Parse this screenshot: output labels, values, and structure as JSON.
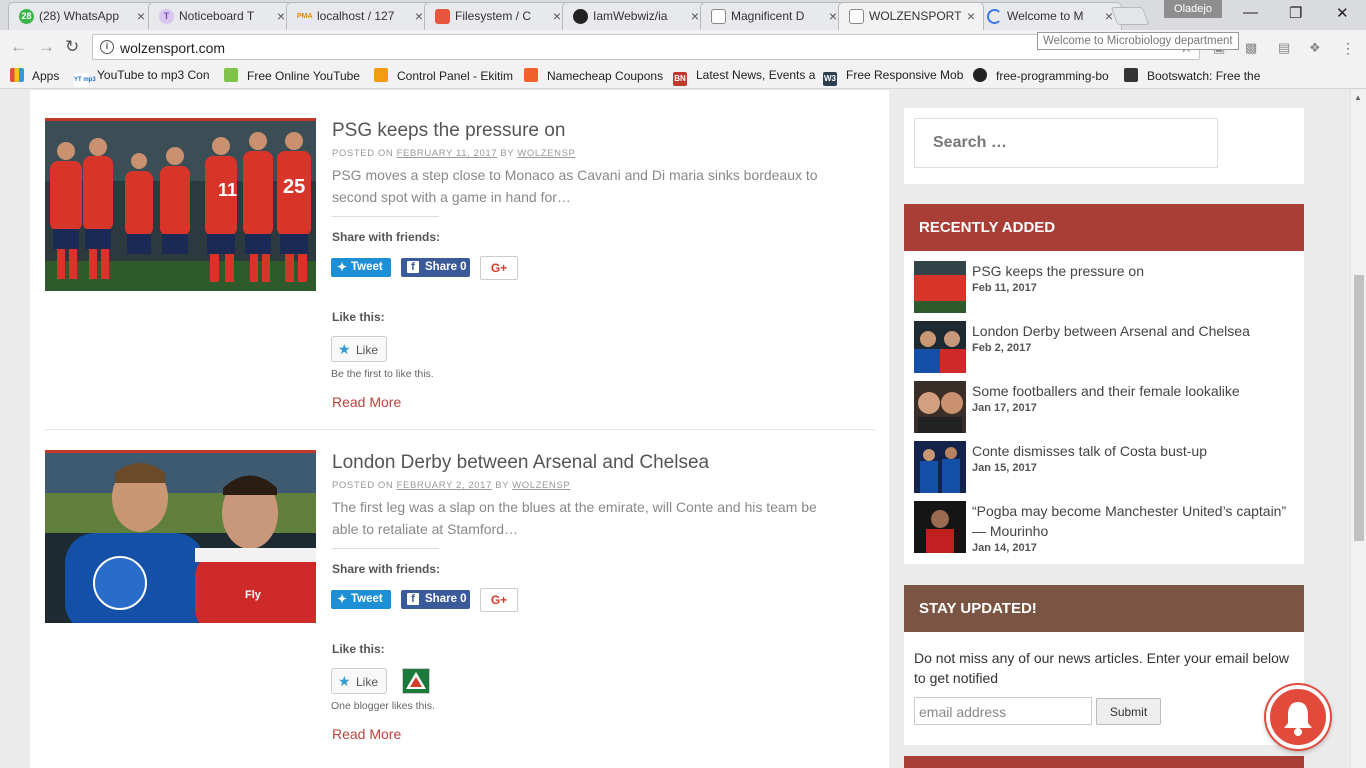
{
  "browser": {
    "tabs": [
      {
        "label": "(28) WhatsApp",
        "badge": "28"
      },
      {
        "label": "Noticeboard T",
        "badge": "T"
      },
      {
        "label": "localhost / 127",
        "badge": "PMA"
      },
      {
        "label": "Filesystem / C",
        "badge": ""
      },
      {
        "label": "IamWebwiz/ia",
        "badge": ""
      },
      {
        "label": "Magnificent D",
        "badge": ""
      },
      {
        "label": "WOLZENSPORT",
        "badge": ""
      },
      {
        "label": "Welcome to M",
        "badge": ""
      }
    ],
    "close_glyph": "×",
    "profile": "Oladejo",
    "url": "wolzensport.com",
    "tooltip": "Welcome to Microbiology department",
    "bookmarks": [
      {
        "label": "Apps"
      },
      {
        "label": "YouTube to mp3 Con",
        "icon": "YT mp3"
      },
      {
        "label": "Free Online YouTube"
      },
      {
        "label": "Control Panel - Ekitim"
      },
      {
        "label": "Namecheap Coupons"
      },
      {
        "label": "Latest News, Events a",
        "icon": "BN"
      },
      {
        "label": "Free Responsive Mob",
        "icon": "W3"
      },
      {
        "label": "free-programming-bo"
      },
      {
        "label": "Bootswatch: Free the"
      }
    ]
  },
  "posts": [
    {
      "title": "PSG keeps the pressure on",
      "posted_on": "POSTED ON",
      "date": "FEBRUARY 11, 2017",
      "by": "BY",
      "author": "WOLZENSP",
      "excerpt": "PSG moves a step close to Monaco as Cavani and Di maria sinks bordeaux to second spot with a game in hand for…",
      "share_heading": "Share with friends:",
      "tweet": "Tweet",
      "share": "Share 0",
      "gplus": "G+",
      "like_heading": "Like this:",
      "like": "Like",
      "like_note": "Be the first to like this.",
      "read_more": "Read More"
    },
    {
      "title": "London Derby between Arsenal and Chelsea",
      "posted_on": "POSTED ON",
      "date": "FEBRUARY 2, 2017",
      "by": "BY",
      "author": "WOLZENSP",
      "excerpt": "The first leg was a slap on the blues at the emirate, will Conte and his team be able to retaliate at Stamford…",
      "share_heading": "Share with friends:",
      "tweet": "Tweet",
      "share": "Share 0",
      "gplus": "G+",
      "like_heading": "Like this:",
      "like": "Like",
      "like_note": "One blogger likes this.",
      "read_more": "Read More"
    }
  ],
  "sidebar": {
    "search_placeholder": "Search …",
    "recent_heading": "RECENTLY ADDED",
    "recent": [
      {
        "title": "PSG keeps the pressure on",
        "date": "Feb 11, 2017"
      },
      {
        "title": "London Derby between Arsenal and Chelsea",
        "date": "Feb 2, 2017"
      },
      {
        "title": "Some footballers and their female lookalike",
        "date": "Jan 17, 2017"
      },
      {
        "title": "Conte dismisses talk of Costa bust-up",
        "date": "Jan 15, 2017"
      },
      {
        "title": "“Pogba may become Manchester United’s captain” — Mourinho",
        "date": "Jan 14, 2017"
      }
    ],
    "stay_heading": "STAY UPDATED!",
    "stay_text": "Do not miss any of our news articles. Enter your email below to get notified",
    "email_placeholder": "email address",
    "submit": "Submit"
  },
  "colors": {
    "accent_red": "#a83e35",
    "stay_brown": "#7a5544",
    "read_more": "#b8433a",
    "tweet_blue": "#1d8fd6",
    "facebook_blue": "#3b5a9a"
  }
}
